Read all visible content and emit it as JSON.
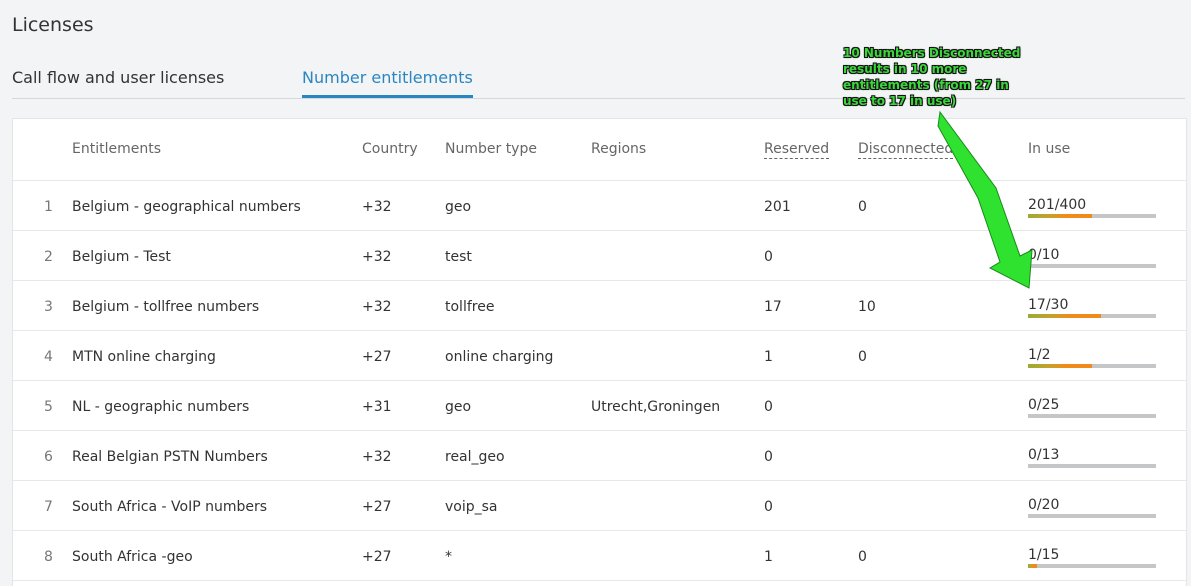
{
  "page": {
    "title": "Licenses"
  },
  "tabs": [
    {
      "label": "Call flow and user licenses",
      "active": false
    },
    {
      "label": "Number entitlements",
      "active": true
    }
  ],
  "table": {
    "columns": {
      "entitlements": "Entitlements",
      "country": "Country",
      "number_type": "Number type",
      "regions": "Regions",
      "reserved": "Reserved",
      "disconnected": "Disconnected",
      "in_use": "In use"
    },
    "rows": [
      {
        "index": "1",
        "name": "Belgium - geographical numbers",
        "country": "+32",
        "type": "geo",
        "regions": "",
        "reserved": "201",
        "disconnected": "0",
        "in_use": "201/400",
        "fill": 0.5025
      },
      {
        "index": "2",
        "name": "Belgium - Test",
        "country": "+32",
        "type": "test",
        "regions": "",
        "reserved": "0",
        "disconnected": "",
        "in_use": "0/10",
        "fill": 0
      },
      {
        "index": "3",
        "name": "Belgium - tollfree numbers",
        "country": "+32",
        "type": "tollfree",
        "regions": "",
        "reserved": "17",
        "disconnected": "10",
        "in_use": "17/30",
        "fill": 0.5667
      },
      {
        "index": "4",
        "name": "MTN online charging",
        "country": "+27",
        "type": "online charging",
        "regions": "",
        "reserved": "1",
        "disconnected": "0",
        "in_use": "1/2",
        "fill": 0.5
      },
      {
        "index": "5",
        "name": "NL - geographic numbers",
        "country": "+31",
        "type": "geo",
        "regions": "Utrecht,Groningen",
        "reserved": "0",
        "disconnected": "",
        "in_use": "0/25",
        "fill": 0
      },
      {
        "index": "6",
        "name": "Real Belgian PSTN Numbers",
        "country": "+32",
        "type": "real_geo",
        "regions": "",
        "reserved": "0",
        "disconnected": "",
        "in_use": "0/13",
        "fill": 0
      },
      {
        "index": "7",
        "name": "South Africa - VoIP numbers",
        "country": "+27",
        "type": "voip_sa",
        "regions": "",
        "reserved": "0",
        "disconnected": "",
        "in_use": "0/20",
        "fill": 0
      },
      {
        "index": "8",
        "name": "South Africa -geo",
        "country": "+27",
        "type": "*",
        "regions": "",
        "reserved": "1",
        "disconnected": "0",
        "in_use": "1/15",
        "fill": 0.0667
      }
    ]
  },
  "annotation": {
    "text": "10 Numbers Disconnected results in 10 more entitlements (from 27 in use to 17 in use)",
    "color": "#3bd63b"
  },
  "colors": {
    "accent": "#2a86c1",
    "bar_track": "#c4c6c8",
    "bar_fill": "#f08a1a"
  }
}
